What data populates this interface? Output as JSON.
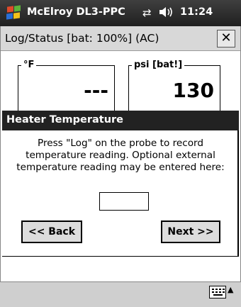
{
  "taskbar": {
    "app_title": "McElroy DL3-PPC",
    "sync_icon": "⇄",
    "volume_icon": "◀€",
    "clock": "11:24"
  },
  "window": {
    "title": "Log/Status  [bat: 100%] (AC)",
    "close_label": "✕"
  },
  "readouts": {
    "temp": {
      "label": "°F",
      "value": "---"
    },
    "psi": {
      "label": "psi [bat!]",
      "value": "130"
    }
  },
  "dialog": {
    "title": "Heater Temperature",
    "message": "Press \"Log\" on the probe to record temperature reading.  Optional external temperature reading may be entered here:",
    "input_value": "",
    "back_label": "<< Back",
    "next_label": "Next >>"
  },
  "bottom": {
    "keyboard_icon": "keyboard-icon",
    "arrow": "▲"
  }
}
